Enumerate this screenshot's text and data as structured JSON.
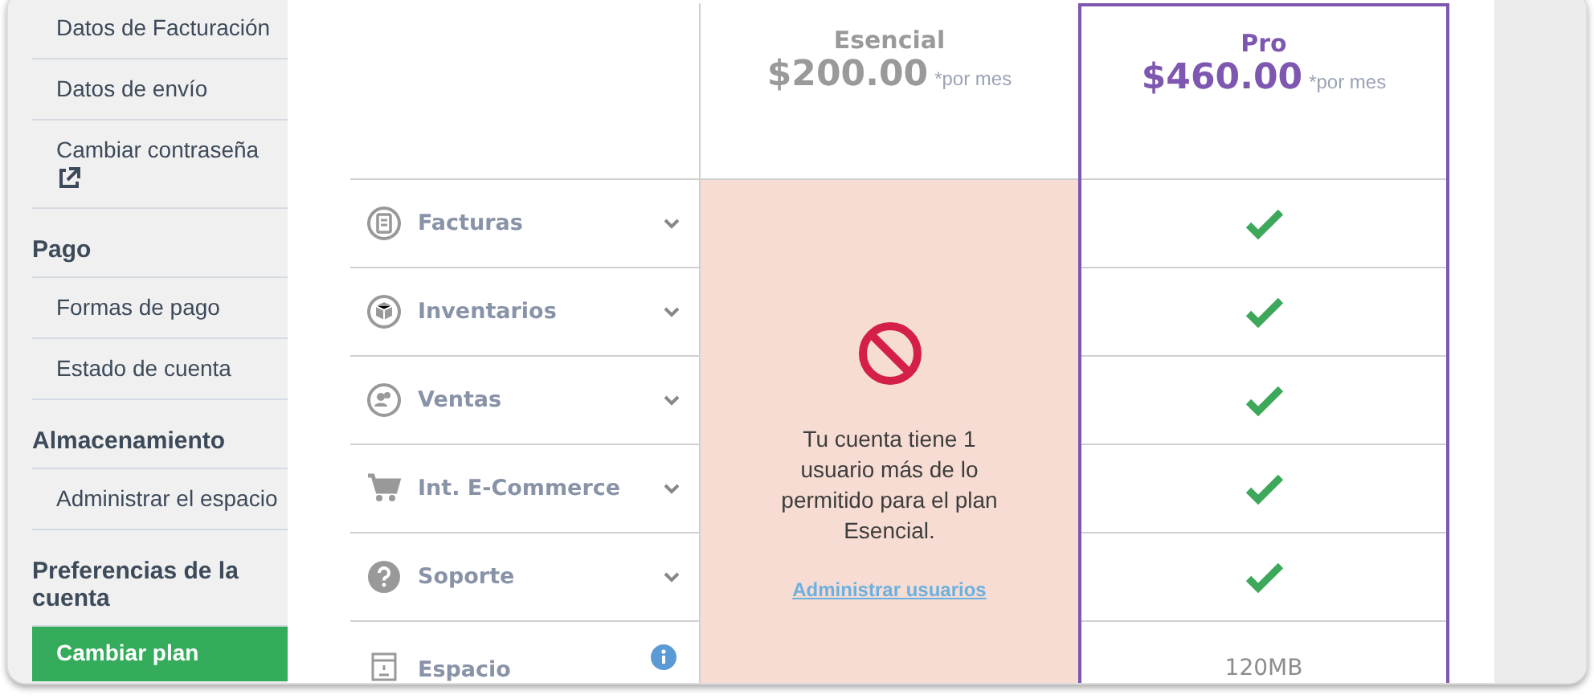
{
  "sidebar": {
    "items": [
      {
        "kind": "item",
        "label": "Datos de Facturación",
        "selected": false
      },
      {
        "kind": "item",
        "label": "Datos de envío",
        "selected": false
      },
      {
        "kind": "external",
        "label": "Cambiar contraseña",
        "selected": false
      },
      {
        "kind": "heading",
        "label": "Pago"
      },
      {
        "kind": "item",
        "label": "Formas de pago",
        "selected": false
      },
      {
        "kind": "item",
        "label": "Estado de cuenta",
        "selected": false
      },
      {
        "kind": "heading",
        "label": "Almacenamiento"
      },
      {
        "kind": "item",
        "label": "Administrar el espacio",
        "selected": false
      },
      {
        "kind": "heading",
        "label": "Preferencias de la cuenta"
      },
      {
        "kind": "item",
        "label": "Cambiar plan",
        "selected": true
      }
    ]
  },
  "features": [
    {
      "kind": "expandable",
      "label": "Facturas"
    },
    {
      "kind": "expandable",
      "label": "Inventarios"
    },
    {
      "kind": "expandable",
      "label": "Ventas"
    },
    {
      "kind": "expandable",
      "label": "Int. E-Commerce"
    },
    {
      "kind": "expandable",
      "label": "Soporte"
    },
    {
      "kind": "info",
      "label": "Espacio"
    }
  ],
  "plans": [
    {
      "name": "Esencial",
      "price": "$200.00",
      "period": "*por mes",
      "highlighted": false,
      "notice": {
        "text": "Tu cuenta tiene 1 usuario más de lo permitido para el plan Esencial.",
        "link": "Administrar usuarios"
      }
    },
    {
      "name": "Pro",
      "price": "$460.00",
      "period": "*por mes",
      "highlighted": true,
      "cells": [
        {
          "kind": "check"
        },
        {
          "kind": "check"
        },
        {
          "kind": "check"
        },
        {
          "kind": "check"
        },
        {
          "kind": "check"
        },
        {
          "kind": "text",
          "value": "120MB"
        }
      ]
    }
  ]
}
